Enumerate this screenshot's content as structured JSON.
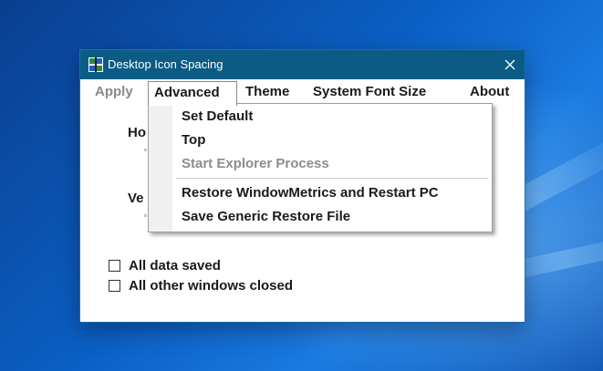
{
  "window": {
    "title": "Desktop Icon Spacing"
  },
  "menu": {
    "items": [
      {
        "label": "Apply",
        "state": "disabled"
      },
      {
        "label": "Advanced",
        "state": "open"
      },
      {
        "label": "Theme",
        "state": "normal"
      },
      {
        "label": "System Font Size",
        "state": "normal"
      },
      {
        "label": "About",
        "state": "normal"
      }
    ]
  },
  "dropdown": {
    "items": [
      {
        "label": "Set Default",
        "enabled": true
      },
      {
        "label": "Top",
        "enabled": true
      },
      {
        "label": "Start Explorer Process",
        "enabled": false
      },
      {
        "label": "Restore WindowMetrics and Restart PC",
        "enabled": true
      },
      {
        "label": "Save Generic Restore File",
        "enabled": true
      }
    ]
  },
  "body": {
    "horizontal_label": "Ho",
    "vertical_label": "Ve"
  },
  "checkboxes": [
    {
      "label": "All data saved",
      "checked": false
    },
    {
      "label": "All other windows closed",
      "checked": false
    }
  ],
  "colors": {
    "titlebar": "#0b5b84",
    "disabled_text": "#8a8a8a"
  }
}
